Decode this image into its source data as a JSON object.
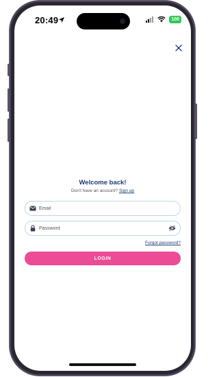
{
  "status_bar": {
    "time": "20:49",
    "battery": "100"
  },
  "login": {
    "title": "Welcome back!",
    "no_account_text": "Don't have an account?",
    "signup_link": "Sign up",
    "email": {
      "placeholder": "Email",
      "value": ""
    },
    "password": {
      "placeholder": "Password",
      "value": ""
    },
    "forgot_password": "Forgot password?",
    "login_button": "LOGIN"
  },
  "colors": {
    "primary_text": "#1d3a7a",
    "button": "#ec4b95",
    "field_border": "#b9d7e8",
    "battery": "#34c759"
  },
  "icons": [
    "location-arrow-icon",
    "signal-icon",
    "wifi-icon",
    "battery-icon",
    "close-icon",
    "email-icon",
    "lock-icon",
    "eye-slash-icon"
  ]
}
